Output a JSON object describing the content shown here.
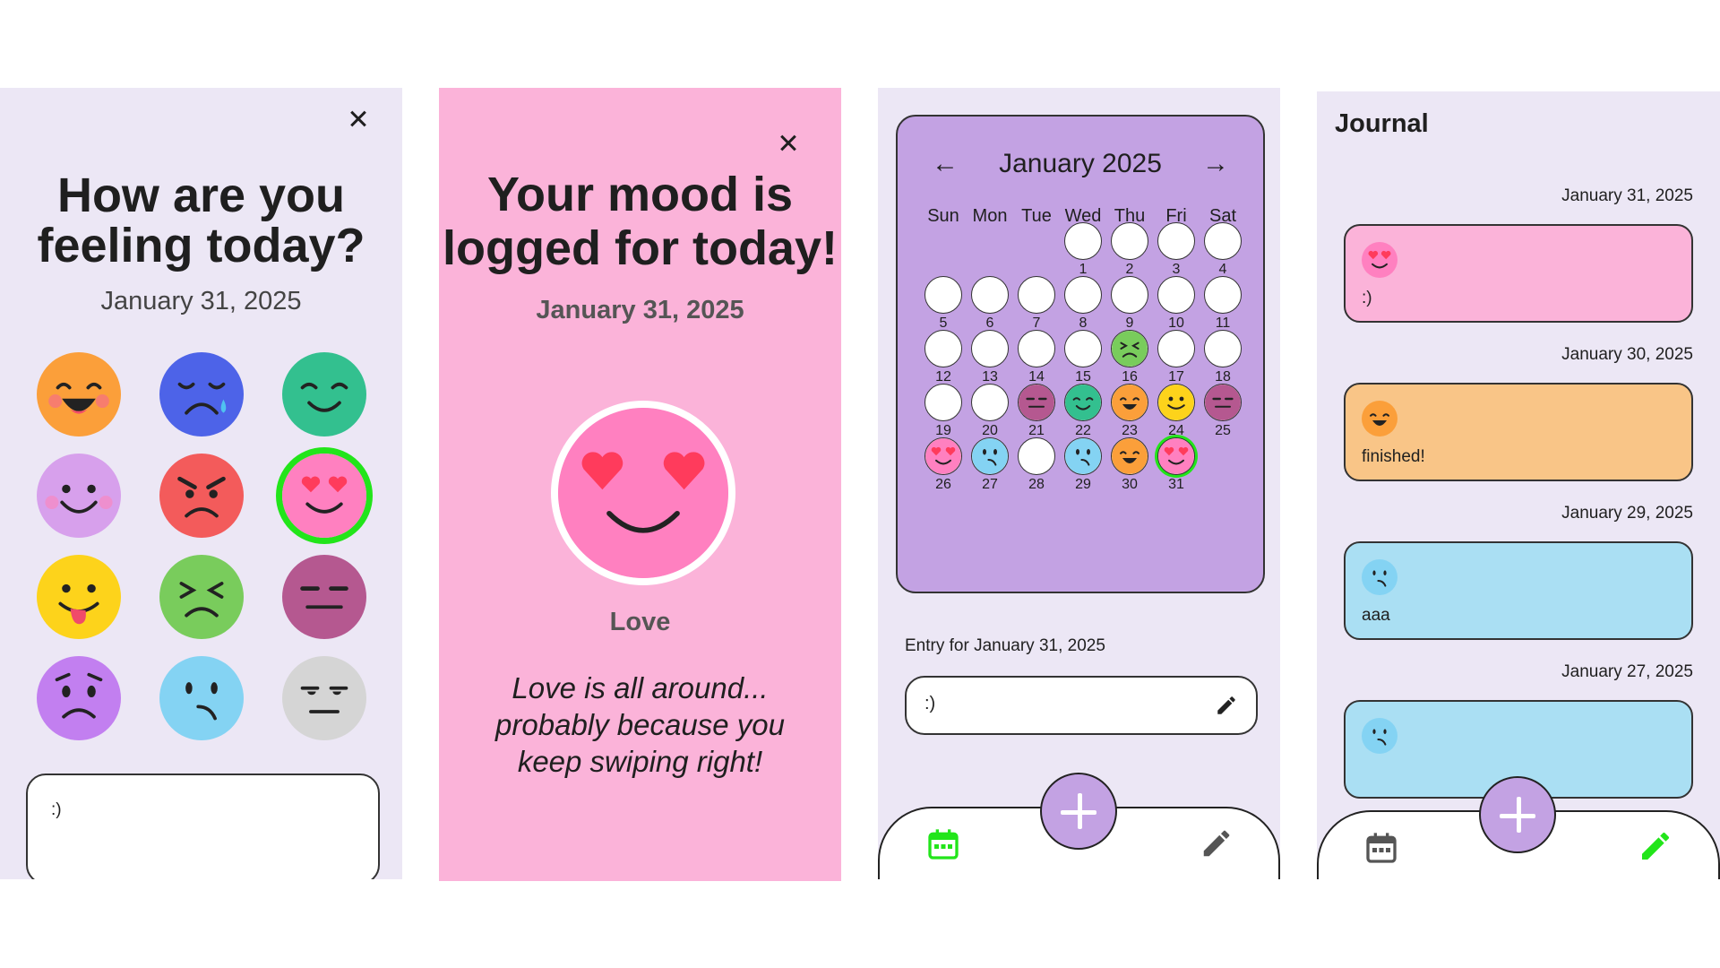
{
  "screen1": {
    "close_symbol": "×",
    "title_line1": "How are you",
    "title_line2": "feeling today?",
    "date": "January 31, 2025",
    "note": ":)"
  },
  "screen2": {
    "title_line1": "Your mood is",
    "title_line2": "logged for today!",
    "date": "January 31, 2025",
    "mood": "Love",
    "quote_line1": "Love is all around...",
    "quote_line2": "probably because you",
    "quote_line3": "keep swiping right!"
  },
  "screen3": {
    "month_title": "January 2025",
    "prev_arrow": "←",
    "next_arrow": "→",
    "weekdays": [
      "Sun",
      "Mon",
      "Tue",
      "Wed",
      "Thu",
      "Fri",
      "Sat"
    ],
    "days": [
      "1",
      "2",
      "3",
      "4",
      "5",
      "6",
      "7",
      "8",
      "9",
      "10",
      "11",
      "12",
      "13",
      "14",
      "15",
      "16",
      "17",
      "18",
      "19",
      "20",
      "21",
      "22",
      "23",
      "24",
      "25",
      "26",
      "27",
      "28",
      "29",
      "30",
      "31"
    ],
    "entry_label": "Entry for January 31, 2025",
    "entry_text": ":)"
  },
  "screen4": {
    "title": "Journal",
    "entries": [
      {
        "date": "January 31, 2025",
        "text": ":)"
      },
      {
        "date": "January 30, 2025",
        "text": "finished!"
      },
      {
        "date": "January 29, 2025",
        "text": "aaa"
      },
      {
        "date": "January 27, 2025",
        "text": ""
      }
    ]
  },
  "colors": {
    "accent_green": "#22e51a",
    "lavender": "#c3a2e3",
    "pink": "#fbb3d9",
    "love": "#ff80c0",
    "happy": "#fb9f3a",
    "sad": "#4d63e8",
    "calm": "#33c08f",
    "blush": "#d7a0ec",
    "angry": "#f35b5b",
    "silly": "#fdd31b",
    "disgust": "#79cc5c",
    "neutral": "#b55890",
    "anxious": "#c27ff0",
    "worried": "#84d3f3",
    "meh": "#d5d5d5"
  }
}
